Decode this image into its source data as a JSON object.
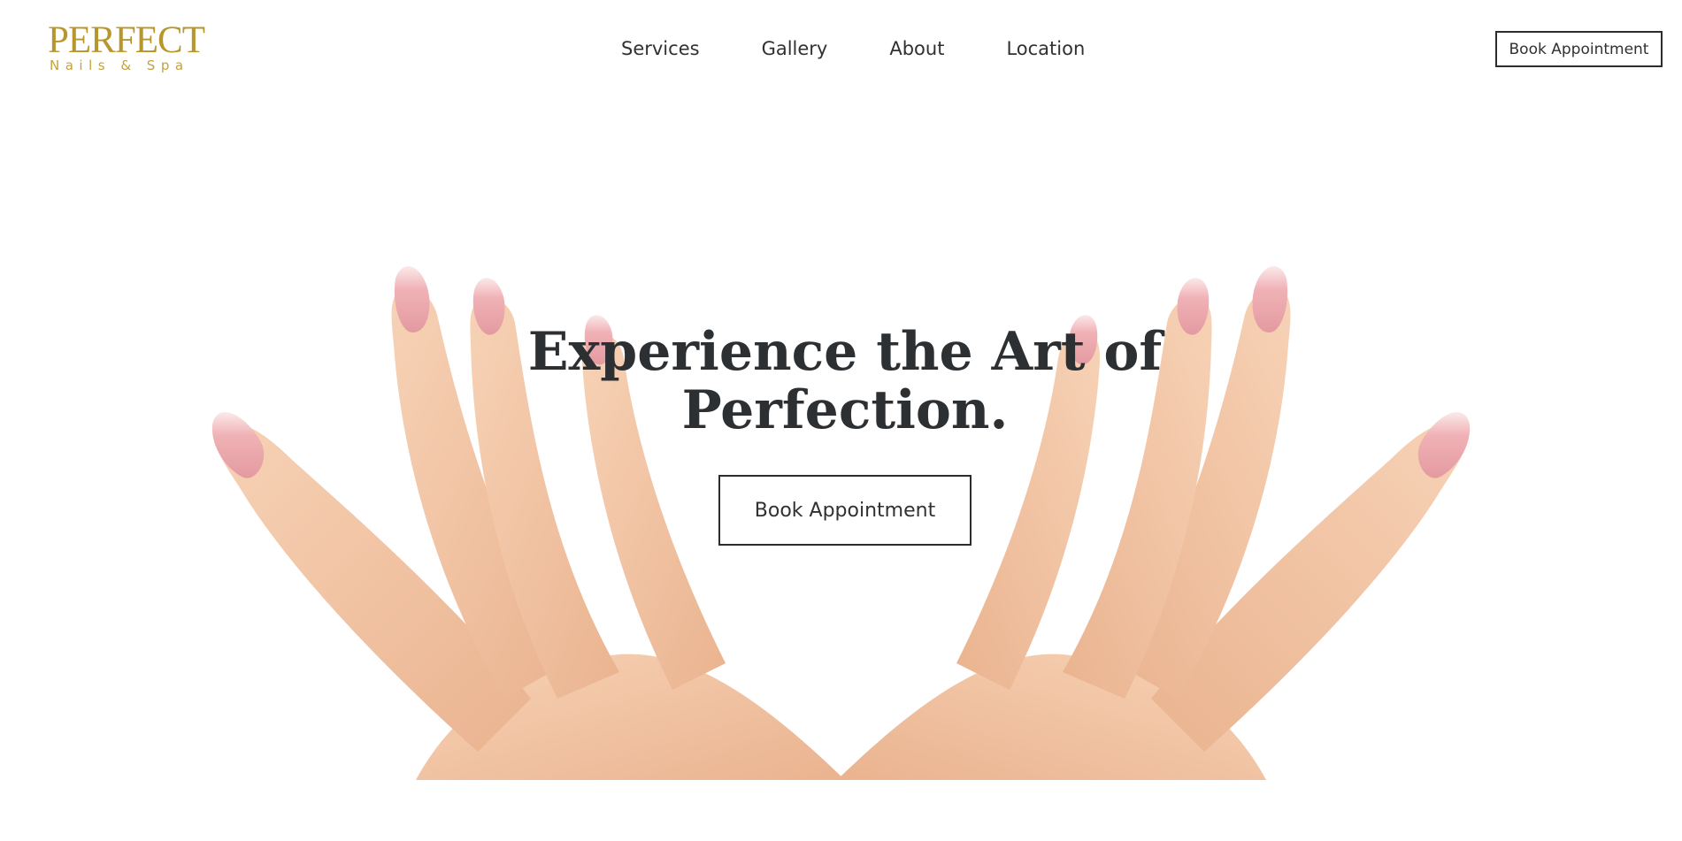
{
  "brand": {
    "name": "PERFECT",
    "tagline": "Nails & Spa",
    "color": "#b8962e"
  },
  "nav": {
    "items": [
      {
        "label": "Services"
      },
      {
        "label": "Gallery"
      },
      {
        "label": "About"
      },
      {
        "label": "Location"
      }
    ]
  },
  "header": {
    "cta_label": "Book Appointment"
  },
  "hero": {
    "title_line1": "Experience the Art of",
    "title_line2": "Perfection.",
    "cta_label": "Book Appointment",
    "image_description_icon": "manicured-hands-image"
  },
  "colors": {
    "text": "#2f3133",
    "heading": "#2d3033",
    "background": "#ffffff",
    "skin": "#f2c4a4",
    "nail": "#e8a0a6"
  }
}
